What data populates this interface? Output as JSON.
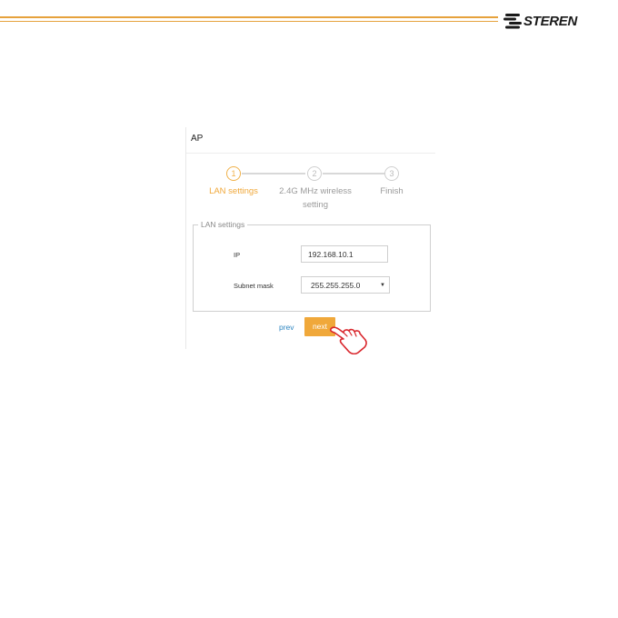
{
  "header": {
    "logo_text": "STEREN"
  },
  "panel": {
    "title": "AP"
  },
  "steps": [
    {
      "number": "1",
      "label": "LAN settings",
      "active": true
    },
    {
      "number": "2",
      "label_line1": "2.4G MHz wireless",
      "label_line2": "setting",
      "active": false
    },
    {
      "number": "3",
      "label": "Finish",
      "active": false
    }
  ],
  "lan": {
    "legend": "LAN settings",
    "ip_label": "IP",
    "ip_value": "192.168.10.1",
    "mask_label": "Subnet mask",
    "mask_value": "255.255.255.0"
  },
  "buttons": {
    "prev": "prev",
    "next": "next"
  },
  "colors": {
    "accent": "#f0a83a",
    "link": "#2e86c1",
    "header_line": "#e6a23c"
  },
  "icons": {
    "pointer": "hand-pointer-icon",
    "select": "caret-down-icon",
    "logo": "steren-logo-icon"
  }
}
